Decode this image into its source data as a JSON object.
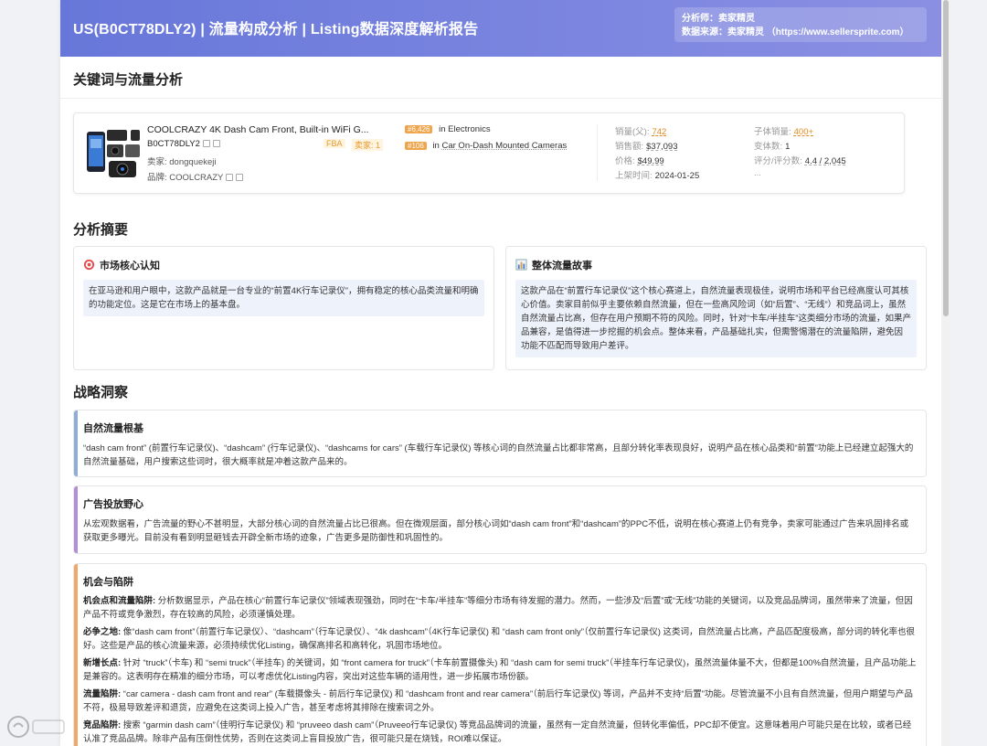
{
  "header": {
    "title": "US(B0CT78DLY2) | 流量构成分析 | Listing数据深度解析报告",
    "analyst": "分析师：卖家精灵",
    "source": "数据来源：卖家精灵 （https://www.sellersprite.com）"
  },
  "section1": {
    "title": "关键词与流量分析"
  },
  "product": {
    "title": "COOLCRAZY 4K Dash Cam Front, Built-in WiFi G...",
    "asin": "B0CT78DLY2",
    "fba": "FBA",
    "seller_count": "卖家: 1",
    "seller": "卖家: dongquekeji",
    "brand": "品牌: COOLCRAZY",
    "rank1_badge": "#6,426",
    "rank1_in": "in",
    "rank1_cat": "Electronics",
    "rank2_badge": "#106",
    "rank2_in": "in",
    "rank2_cat": "Car On-Dash Mounted Cameras",
    "stats_left": [
      {
        "label": "销量(父):",
        "value": "742"
      },
      {
        "label": "销售额:",
        "value": "$37,093"
      },
      {
        "label": "价格:",
        "value": "$49.99"
      },
      {
        "label": "上架时间:",
        "value": "2024-01-25"
      }
    ],
    "stats_right": [
      {
        "label": "子体销量:",
        "value": "400+"
      },
      {
        "label": "变体数:",
        "value": "1"
      },
      {
        "label": "评分/评分数:",
        "value": "4.4 / 2,045"
      },
      {
        "label": "...",
        "value": ""
      }
    ]
  },
  "section2": {
    "title": "分析摘要"
  },
  "summary": [
    {
      "icon": "target-icon",
      "title": "市场核心认知",
      "body": "在亚马逊和用户眼中，这款产品就是一台专业的“前置4K行车记录仪”，拥有稳定的核心品类流量和明确的功能定位。这是它在市场上的基本盘。"
    },
    {
      "icon": "chart-icon",
      "title": "整体流量故事",
      "body": "这款产品在“前置行车记录仪”这个核心赛道上，自然流量表现极佳，说明市场和平台已经高度认可其核心价值。卖家目前似乎主要依赖自然流量，但在一些高风险词（如“后置”、“无线”）和竞品词上，虽然自然流量占比高，但存在用户预期不符的风险。同时，针对“卡车/半挂车”这类细分市场的流量，如果产品兼容，是值得进一步挖掘的机会点。整体来看，产品基础扎实，但需警惕潜在的流量陷阱，避免因功能不匹配而导致用户差评。"
    }
  ],
  "section3": {
    "title": "战略洞察"
  },
  "insights": {
    "natural": {
      "title": "自然流量根基",
      "color": "#8eaed6",
      "body": "“dash cam front” (前置行车记录仪)、“dashcam” (行车记录仪)、“dashcams for cars” (车载行车记录仪) 等核心词的自然流量占比都非常高，且部分转化率表现良好，说明产品在核心品类和“前置”功能上已经建立起强大的自然流量基础，用户搜索这些词时，很大概率就是冲着这款产品来的。"
    },
    "ads": {
      "title": "广告投放野心",
      "color": "#b48ed6",
      "body": "从宏观数据看，广告流量的野心不甚明显，大部分核心词的自然流量占比已很高。但在微观层面，部分核心词如“dash cam front”和“dashcam”的PPC不低，说明在核心赛道上仍有竞争，卖家可能通过广告来巩固排名或获取更多曝光。目前没有看到明显砸钱去开辟全新市场的迹象，广告更多是防御性和巩固性的。"
    },
    "opps": {
      "title": "机会与陷阱",
      "color": "#f0a86a",
      "paras": [
        {
          "lead": "机会点和流量陷阱:",
          "text": " 分析数据显示，产品在核心“前置行车记录仪”领域表现强劲，同时在“卡车/半挂车”等细分市场有待发掘的潜力。然而，一些涉及“后置”或“无线”功能的关键词，以及竞品品牌词，虽然带来了流量，但因产品不符或竞争激烈，存在较高的风险，必须谨慎处理。"
        },
        {
          "lead": "必争之地:",
          "text": " 像“dash cam front”（前置行车记录仪）、“dashcam”（行车记录仪）、“4k dashcam”（4K行车记录仪) 和 “dash cam front only”（仅前置行车记录仪) 这类词，自然流量占比高，产品匹配度极高，部分词的转化率也很好。这些是产品的核心流量来源，必须持续优化Listing，确保高排名和高转化，巩固市场地位。"
        },
        {
          "lead": "新增长点:",
          "text": " 针对 “truck”（卡车) 和 “semi truck”（半挂车) 的关键词，如 “front camera for truck”（卡车前置摄像头) 和 “dash cam for semi truck”（半挂车行车记录仪)，虽然流量体量不大，但都是100%自然流量，且产品功能上是兼容的。这表明存在精准的细分市场，可以考虑优化Listing内容，突出对这些车辆的适用性，进一步拓展市场份额。"
        },
        {
          "lead": "流量陷阱:",
          "text": " “car camera - dash cam front and rear” (车载摄像头 - 前后行车记录仪) 和 “dashcam front and rear camera”（前后行车记录仪) 等词，产品并不支持“后置”功能。尽管流量不小且有自然流量，但用户期望与产品不符，极易导致差评和退货，应避免在这类词上投入广告，甚至考虑将其排除在搜索词之外。"
        },
        {
          "lead": "竞品陷阱:",
          "text": " 搜索 “garmin dash cam”（佳明行车记录仪) 和 “pruveeo dash cam”（Pruveeo行车记录仪) 等竞品品牌词的流量，虽然有一定自然流量，但转化率偏低，PPC却不便宜。这意味着用户可能只是在比较，或者已经认准了竞品品牌。除非产品有压倒性优势，否则在这类词上盲目投放广告，很可能只是在烧钱，ROI难以保证。"
        }
      ]
    }
  }
}
